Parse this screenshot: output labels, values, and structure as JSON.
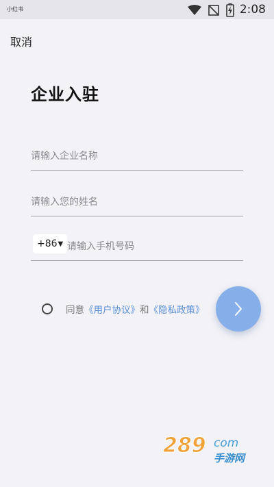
{
  "status_bar": {
    "app_name": "小红书",
    "time": "2:08",
    "icons": [
      "wifi-icon",
      "no-signal-icon",
      "battery-charging-icon"
    ]
  },
  "header": {
    "cancel_label": "取消"
  },
  "page": {
    "title": "企业入驻"
  },
  "form": {
    "company_placeholder": "请输入企业名称",
    "name_placeholder": "请输入您的姓名",
    "country_code": "+86",
    "phone_placeholder": "请输入手机号码"
  },
  "agreement": {
    "prefix": "同意",
    "user_agreement": "《用户协议》",
    "conjunction": "和",
    "privacy_policy": "《隐私政策》",
    "checked": false
  },
  "next_button": {
    "icon": "chevron-right-icon",
    "color": "#86aee8"
  },
  "watermark": {
    "number": "289",
    "suffix": "com",
    "text": "手游网"
  },
  "colors": {
    "background": "#f3f2f7",
    "link": "#5a8fd8",
    "accent": "#86aee8"
  }
}
